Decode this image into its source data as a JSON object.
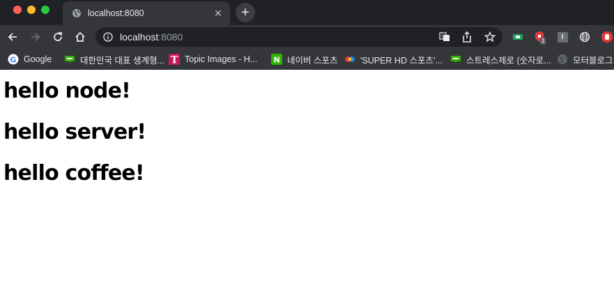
{
  "tab": {
    "title": "localhost:8080",
    "close_glyph": "✕"
  },
  "newtab": {
    "glyph": "+"
  },
  "omnibox": {
    "host": "localhost",
    "port": ":8080"
  },
  "extensions": {
    "badge_count": "1",
    "letter_ext": "I"
  },
  "bookmarks": [
    {
      "label": "Google",
      "icon": "google-icon"
    },
    {
      "label": "대한민국 대표 생계형...",
      "icon": "naver-blog-icon"
    },
    {
      "label": "Topic Images - H...",
      "icon": "t-icon"
    },
    {
      "label": "네이버 스포츠",
      "icon": "naver-icon"
    },
    {
      "label": "'SUPER HD 스포츠'...",
      "icon": "sports-icon"
    },
    {
      "label": "스트레스제로 (숫자로...",
      "icon": "naver-blog-icon"
    },
    {
      "label": "모터블로그 r",
      "icon": "globe-icon"
    }
  ],
  "page": {
    "headings": [
      "hello node!",
      "hello server!",
      "hello coffee!"
    ]
  }
}
